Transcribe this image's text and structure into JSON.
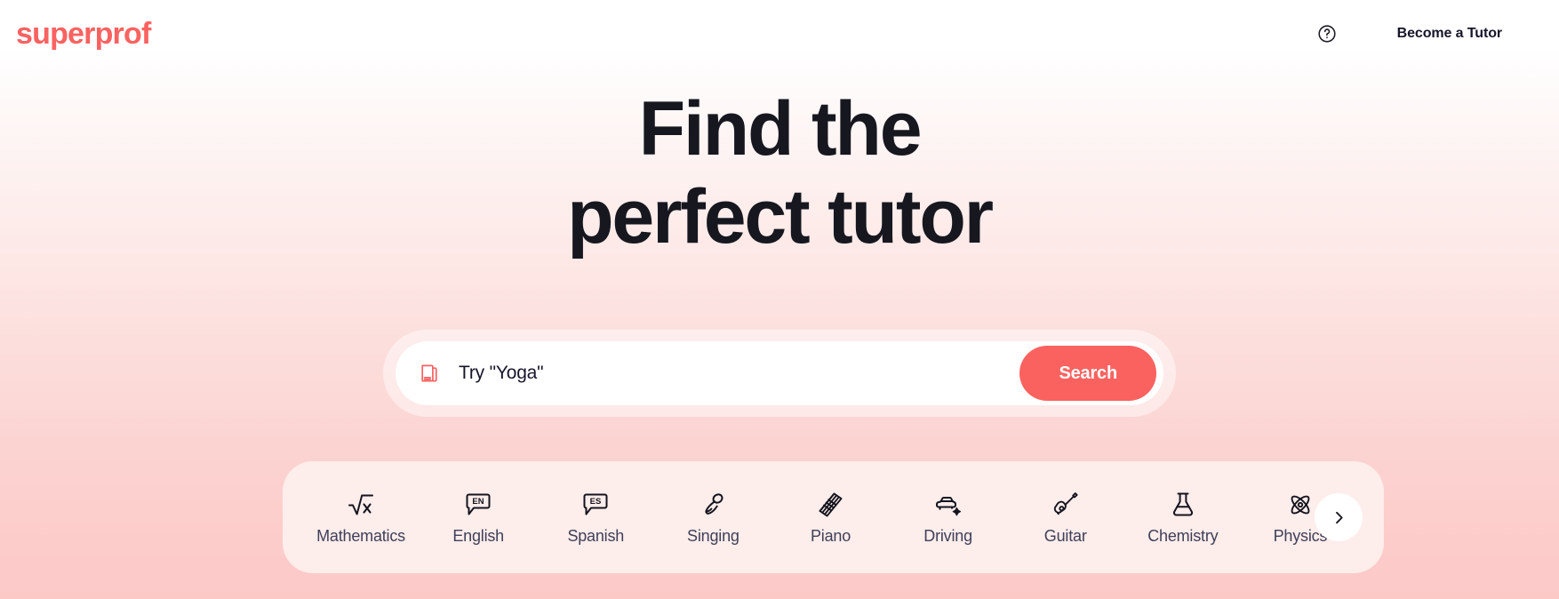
{
  "header": {
    "logo_text": "superprof",
    "help_icon": "help-circle-icon",
    "become_tutor_label": "Become a Tutor"
  },
  "hero": {
    "title_line1": "Find the",
    "title_line2": "perfect tutor"
  },
  "search": {
    "icon": "book-icon",
    "placeholder": "Try \"Yoga\"",
    "value": "",
    "button_label": "Search"
  },
  "categories": {
    "next_icon": "chevron-right-icon",
    "items": [
      {
        "label": "Mathematics",
        "icon": "square-root-icon"
      },
      {
        "label": "English",
        "icon": "speech-bubble-en-icon",
        "badge": "EN"
      },
      {
        "label": "Spanish",
        "icon": "speech-bubble-es-icon",
        "badge": "ES"
      },
      {
        "label": "Singing",
        "icon": "microphone-icon"
      },
      {
        "label": "Piano",
        "icon": "piano-icon"
      },
      {
        "label": "Driving",
        "icon": "car-icon"
      },
      {
        "label": "Guitar",
        "icon": "guitar-icon"
      },
      {
        "label": "Chemistry",
        "icon": "flask-icon"
      },
      {
        "label": "Physics",
        "icon": "atom-icon"
      }
    ]
  },
  "colors": {
    "brand_coral": "#fa6260",
    "text_dark": "#16162a",
    "strip_bg": "#fdedeb",
    "page_bg_top": "#ffffff",
    "page_bg_bottom": "#fcc9c7"
  }
}
